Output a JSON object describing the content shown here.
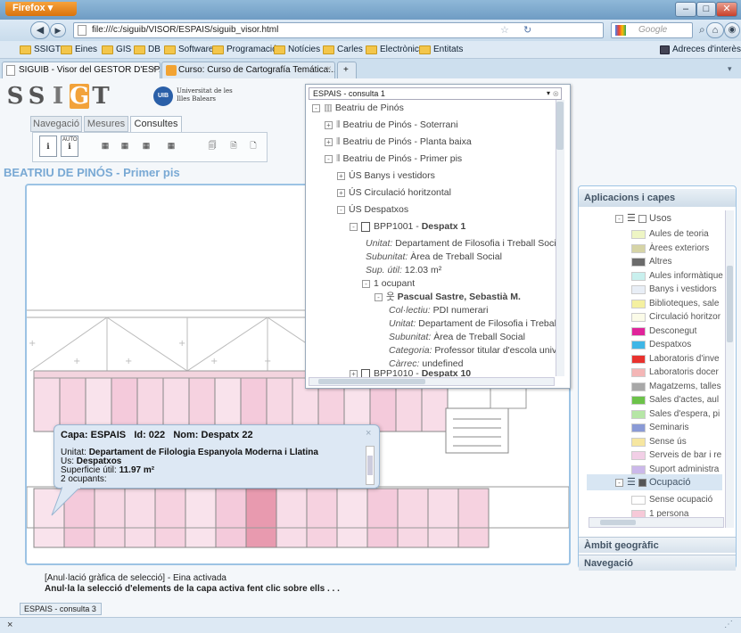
{
  "browser": {
    "menu_label": "Firefox ▾",
    "url": "file:///c:/siguib/VISOR/ESPAIS/siguib_visor.html",
    "search_placeholder": "Google",
    "bookmarks": [
      "SSIGT",
      "Eines",
      "GIS",
      "DB",
      "Software",
      "Programació",
      "Notícies",
      "Carles",
      "Electrònica",
      "Entitats"
    ],
    "bookmarks_right": "Adreces d'interès",
    "tabs": [
      {
        "label": "SIGUIB - Visor del GESTOR D'ESPAIS d..."
      },
      {
        "label": "Curso: Curso de Cartografía Temática..."
      }
    ],
    "new_tab": "+"
  },
  "app": {
    "logo_letters": [
      "S",
      "S",
      "I",
      "G",
      "T"
    ],
    "uib_name": "Universitat de les Illes Balears",
    "uib_badge": "UIB",
    "tabs": [
      "Navegació",
      "Mesures",
      "Consultes"
    ],
    "tool_auto": "AUTO",
    "heading": "BEATRIU DE PINÓS - Primer pis"
  },
  "consulta": {
    "header": "ESPAIS - consulta 1",
    "tree": {
      "root": "Beatriu de Pinós",
      "soterrani": "Beatriu de Pinós - Soterrani",
      "planta_baixa": "Beatriu de Pinós - Planta baixa",
      "primer_pis": "Beatriu de Pinós - Primer pis",
      "us_banys": "ÚS Banys i vestidors",
      "us_circulacio": "ÚS Circulació horitzontal",
      "us_despatxos": "ÚS Despatxos",
      "bpp1001": "BPP1001 - ",
      "bpp1001_name": "Despatx 1",
      "unitat_label": "Unitat:",
      "unitat_val": "Departament de Filosofia i Treball Socia",
      "subunitat_label": "Subunitat:",
      "subunitat_val": "Àrea de Treball Social",
      "sup_label": "Sup. útil:",
      "sup_val": "12.03 m²",
      "ocupant": "1 ocupant",
      "person": "Pascual Sastre, Sebastià M.",
      "col_label": "Col·lectiu:",
      "col_val": "PDI numerari",
      "p_unitat_val": "Departament de Filosofia i Treball",
      "p_subunitat_val": "Àrea de Treball Social",
      "cat_label": "Categoria:",
      "cat_val": "Professor titular d'escola unive",
      "carrec_label": "Càrrec:",
      "carrec_val": "undefined",
      "bpp1010": "BPP1010 - ",
      "bpp1010_name": "Despatx 10"
    }
  },
  "right_panel": {
    "title": "Aplicacions i capes",
    "usos_label": "Usos",
    "legend": [
      {
        "label": "Aules de teoria",
        "color": "#eef5c4"
      },
      {
        "label": "Àrees exteriors",
        "color": "#d6d4a6"
      },
      {
        "label": "Altres",
        "color": "#6b6b6b"
      },
      {
        "label": "Aules informàtique",
        "color": "#c9f0ee"
      },
      {
        "label": "Banys i vestidors",
        "color": "#e8eef6"
      },
      {
        "label": "Biblioteques, sale",
        "color": "#f4f0a0"
      },
      {
        "label": "Circulació horitzor",
        "color": "#fbfbe8"
      },
      {
        "label": "Desconegut",
        "color": "#e0249a"
      },
      {
        "label": "Despatxos",
        "color": "#3fb6e6"
      },
      {
        "label": "Laboratoris d'inve",
        "color": "#e8322e"
      },
      {
        "label": "Laboratoris docer",
        "color": "#f4b6b6"
      },
      {
        "label": "Magatzems, talles",
        "color": "#a8a8a8"
      },
      {
        "label": "Sales d'actes, aul",
        "color": "#6cc24a"
      },
      {
        "label": "Sales d'espera, pi",
        "color": "#b6e6a6"
      },
      {
        "label": "Seminaris",
        "color": "#8a9ad6"
      },
      {
        "label": "Sense ús",
        "color": "#f6e6a0"
      },
      {
        "label": "Serveis de bar i re",
        "color": "#f2cfe6"
      },
      {
        "label": "Suport administra",
        "color": "#cbb8ea"
      }
    ],
    "ocupacio_label": "Ocupació",
    "ocupacio_legend": [
      {
        "label": "Sense ocupació",
        "color": "#ffffff"
      },
      {
        "label": "1 persona",
        "color": "#f6c9d8"
      }
    ],
    "accordion": [
      "Àmbit geogràfic",
      "Navegació"
    ]
  },
  "popup": {
    "title": "Capa: ESPAIS   Id: 022   Nom: Despatx 22",
    "unitat_label": "Unitat: ",
    "unitat_val": "Departament de Filologia Espanyola Moderna i Llatina",
    "us_label": "Us: ",
    "us_val": "Despatxos",
    "sup_label": "Superficie útil: ",
    "sup_val": "11.97 m²",
    "ocupants": "2 ocupants:",
    "close": "×"
  },
  "status": {
    "line1": "[Anul·lació gràfica de selecció] - Eina activada",
    "line2": "Anul·la la selecció d'elements de la capa activa fent clic sobre ells . . .",
    "bottom_tab": "ESPAIS - consulta 3",
    "close_x": "×"
  }
}
